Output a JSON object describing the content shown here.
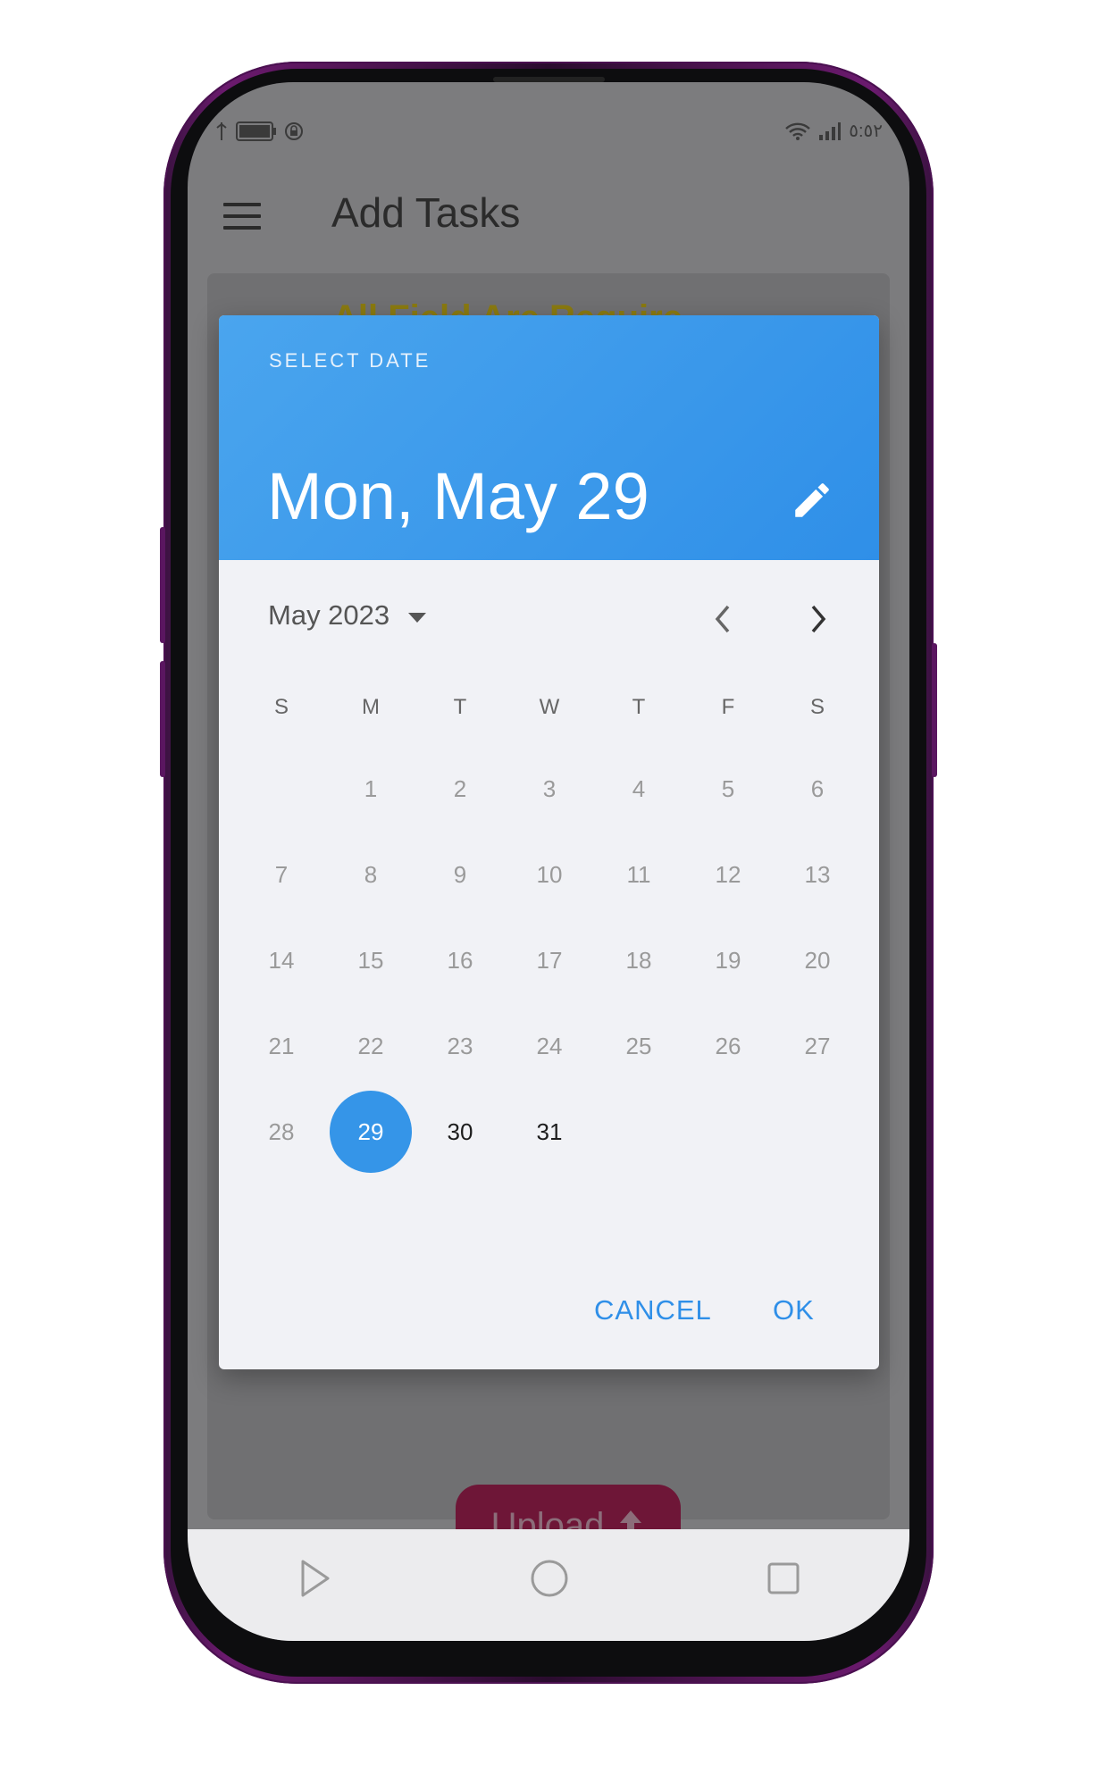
{
  "colors": {
    "accent": "#2f8fe8",
    "header_bg": "#3d9cec",
    "upload_bg": "#6e1637",
    "frame": "#6b1a6e"
  },
  "statusbar": {
    "time": "٥:٥٢",
    "icons": [
      "usb-icon",
      "battery-icon",
      "lock-icon",
      "wifi-icon",
      "signal-icon"
    ]
  },
  "appbar": {
    "title": "Add Tasks",
    "menu_icon": "hamburger-menu-icon"
  },
  "background_content": {
    "required_text": "All Field Are Require",
    "upload_label": "Upload",
    "upload_icon": "upload-arrow-icon"
  },
  "date_picker": {
    "header_label": "SELECT DATE",
    "selected_date": "Mon, May 29",
    "edit_icon": "pencil-icon",
    "month_label": "May 2023",
    "weekdays": [
      "S",
      "M",
      "T",
      "W",
      "T",
      "F",
      "S"
    ],
    "first_weekday_offset": 1,
    "days_in_month": 31,
    "selected_day": 29,
    "selectable_from": 29,
    "cancel_label": "CANCEL",
    "ok_label": "OK"
  },
  "navbar": {
    "icons": [
      "back-triangle-icon",
      "home-circle-icon",
      "recents-square-icon"
    ]
  }
}
